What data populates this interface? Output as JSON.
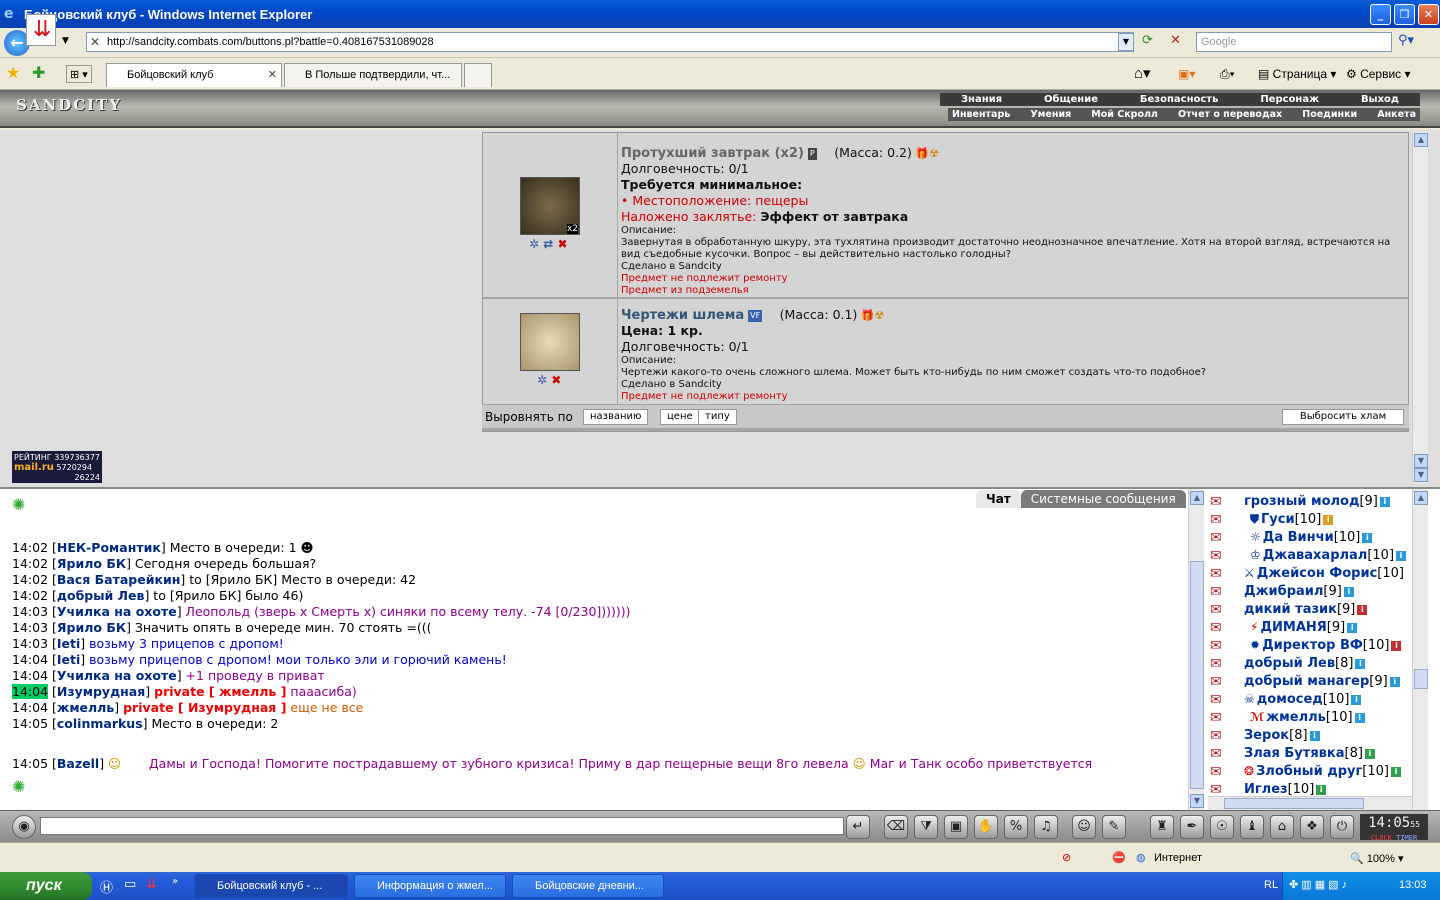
{
  "window": {
    "title": "Бойцовский клуб - Windows Internet Explorer",
    "url": "http://sandcity.combats.com/buttons.pl?battle=0.408167531089028",
    "search_placeholder": "Google"
  },
  "tabs": [
    {
      "label": "Бойцовский клуб"
    },
    {
      "label": "В Польше подтвердили, чт..."
    }
  ],
  "toolbar": {
    "page_label": "Страница",
    "tools_label": "Сервис"
  },
  "game": {
    "logo": "SANDCITY",
    "menu": [
      "Знания",
      "Общение",
      "Безопасность",
      "Персонаж",
      "Выход"
    ],
    "submenu": [
      "Инвентарь",
      "Умения",
      "Мой Скролл",
      "Отчет о переводах",
      "Поединки",
      "Анкета"
    ]
  },
  "items": [
    {
      "name": "Протухший завтрак (x2)",
      "badge": "P",
      "mass": "(Масса: 0.2)",
      "count": "x2",
      "durability": "Долговечность: 0/1",
      "requires": "Требуется минимальное:",
      "location": "• Местоположение: пещеры",
      "spell_label": "Наложено заклятье:",
      "spell_value": "Эффект от завтрака",
      "desc_label": "Описание:",
      "description": "Завернутая в обработанную шкуру, эта тухлятина производит достаточно неоднозначное впечатление. Хотя на второй взгляд, встречаются на вид съедобные кусочки. Вопрос – вы действительно настолько голодны?",
      "made_in": "Сделано в Sandcity",
      "no_repair": "Предмет не подлежит ремонту",
      "from_dungeon": "Предмет из подземелья"
    },
    {
      "name": "Чертежи шлема",
      "badge": "VF",
      "mass": "(Масса: 0.1)",
      "price": "Цена: 1 кр.",
      "durability": "Долговечность: 0/1",
      "desc_label": "Описание:",
      "description": "Чертежи какого-то очень сложного шлема. Может быть кто-нибудь по ним сможет создать что-то подобное?",
      "made_in": "Сделано в Sandcity",
      "no_repair": "Предмет не подлежит ремонту"
    }
  ],
  "sort": {
    "label": "Выровнять по",
    "by_name": "названию",
    "by_price": "цене",
    "by_type": "типу",
    "drop_junk": "Выбросить хлам"
  },
  "counter": {
    "title": "РЕЙТИНГ",
    "num1": "339736377",
    "brand": "mail.ru",
    "num2": "5720294",
    "num3": "26224"
  },
  "chat": {
    "tab_chat": "Чат",
    "tab_system": "Системные сообщения",
    "lines": [
      {
        "time": "14:02",
        "nick": "НЕК-Романтик",
        "text": "Место в очереди: 1"
      },
      {
        "time": "14:02",
        "nick": "Ярило БК",
        "text": "Сегодня очередь большая?"
      },
      {
        "time": "14:02",
        "nick": "Вася Батарейкин",
        "text": "to [Ярило БК] Место в очереди: 42"
      },
      {
        "time": "14:02",
        "nick": "добрый Лев",
        "text": "to [Ярило БК] было 46)"
      },
      {
        "time": "14:03",
        "nick": "Училка на охоте",
        "text": "Леопольд (зверь х Смерть х) синяки по всему телу. -74 [0/230]))))))"
      },
      {
        "time": "14:03",
        "nick": "Ярило БК",
        "text": "Значить опять в очереде мин. 70 стоять =((("
      },
      {
        "time": "14:03",
        "nick": "Ieti",
        "text": "возьму 3 прицепов с дропом!"
      },
      {
        "time": "14:04",
        "nick": "Ieti",
        "text": "возьму прицепов с дропом! мои только эли и горючий камень!"
      },
      {
        "time": "14:04",
        "nick": "Училка на охоте",
        "text": "+1 проведу в приват"
      },
      {
        "time": "14:04",
        "nick": "Изумрудная",
        "private": "private [ жмелль ]",
        "text": "пааасиба)"
      },
      {
        "time": "14:04",
        "nick": "жмелль",
        "private": "private [ Изумрудная ]",
        "text": "еще не все"
      },
      {
        "time": "14:05",
        "nick": "colinmarkus",
        "text": "Место в очереди: 2"
      },
      {
        "time": "14:05",
        "nick": "Bazell",
        "text": "Дамы и Господа! Помогите пострадавшему от зубного кризиса! Приму в дар пещерные вещи 8го левела",
        "text2": "Маг и Танк особо приветствуется"
      }
    ]
  },
  "users": [
    {
      "name": "грозный молод",
      "level": "[9]"
    },
    {
      "name": "Гуси",
      "level": "[10]"
    },
    {
      "name": "Да Винчи",
      "level": "[10]"
    },
    {
      "name": "Джавахарлал",
      "level": "[10]"
    },
    {
      "name": "Джейсон Форис",
      "level": "[10]"
    },
    {
      "name": "Джибраил",
      "level": "[9]"
    },
    {
      "name": "дикий тазик",
      "level": "[9]"
    },
    {
      "name": "ДИМАНЯ",
      "level": "[9]"
    },
    {
      "name": "Директор ВФ",
      "level": "[10]"
    },
    {
      "name": "добрый Лев",
      "level": "[8]"
    },
    {
      "name": "добрый манагер",
      "level": "[9]"
    },
    {
      "name": "домосед",
      "level": "[10]"
    },
    {
      "name": "жмелль",
      "level": "[10]"
    },
    {
      "name": "Зерок",
      "level": "[8]"
    },
    {
      "name": "Злая Бутявка",
      "level": "[8]"
    },
    {
      "name": "Злобный друг",
      "level": "[10]"
    },
    {
      "name": "Иглез",
      "level": "[10]"
    }
  ],
  "clock": {
    "time": "14:05",
    "sec": "55",
    "label1": "CLOCK",
    "label2": "TIMER"
  },
  "status": {
    "zone": "Интернет",
    "zoom": "100%"
  },
  "taskbar": {
    "start": "пуск",
    "buttons": [
      "Бойцовский клуб - ...",
      "Информация о жмел...",
      "Бойцовские дневни..."
    ],
    "lang": "RL",
    "time": "13:03"
  },
  "colors": {
    "accent": "#0054e3",
    "chat_private": "#ee0000",
    "nick": "#002a80"
  }
}
